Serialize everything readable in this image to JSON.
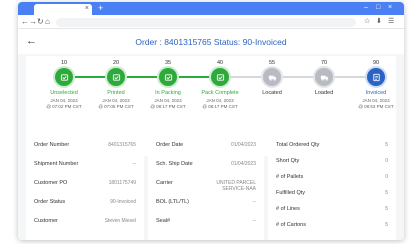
{
  "browser": {
    "new_tab": "+",
    "tab_close": "×",
    "nav_back": "←",
    "nav_forward": "→",
    "nav_reload": "↻",
    "nav_home": "⌂",
    "toolbar_icons": [
      "☆",
      "⬇",
      "☰"
    ],
    "window_controls": [
      "–",
      "□",
      "×"
    ]
  },
  "header": {
    "back": "←",
    "title": "Order : 8401315765  Status: 90-Invoiced"
  },
  "timeline": {
    "colors": {
      "green": "#2eaa3a",
      "grey": "#b8bcc2",
      "blue": "#2a63c4"
    },
    "steps": [
      {
        "number": "10",
        "label": "Unselected",
        "date1": "JAN 04, 2023",
        "date2": "@ 07:02 PM CST",
        "color": "green",
        "icon": "check-icon"
      },
      {
        "number": "20",
        "label": "Printed",
        "date1": "JAN 04, 2023",
        "date2": "@ 07:05 PM CST",
        "color": "green",
        "icon": "check-icon"
      },
      {
        "number": "35",
        "label": "In Packing",
        "date1": "JAN 04, 2023",
        "date2": "@ 08:17 PM CST",
        "color": "green",
        "icon": "check-icon"
      },
      {
        "number": "40",
        "label": "Pack Complete",
        "date1": "JAN 04, 2023",
        "date2": "@ 08:17 PM CST",
        "color": "green",
        "icon": "check-icon"
      },
      {
        "number": "55",
        "label": "Located",
        "date1": "",
        "date2": "",
        "color": "grey",
        "icon": "truck-icon"
      },
      {
        "number": "70",
        "label": "Loaded",
        "date1": "",
        "date2": "",
        "color": "grey",
        "icon": "truck-icon"
      },
      {
        "number": "90",
        "label": "Invoiced",
        "date1": "JAN 04, 2023",
        "date2": "@ 08:53 PM CST",
        "color": "blue",
        "icon": "invoice-icon"
      }
    ]
  },
  "details": {
    "left": [
      {
        "label": "Order Number",
        "value": "8401315765"
      },
      {
        "label": "Shipment Number",
        "value": "--"
      },
      {
        "label": "Customer PO",
        "value": "1801175749"
      },
      {
        "label": "Order Status",
        "value": "90-Invoiced"
      },
      {
        "label": "Customer",
        "value": "Steven Miesel"
      }
    ],
    "middle": [
      {
        "label": "Order Date",
        "value": "01/04/2023"
      },
      {
        "label": "Sch. Ship Date",
        "value": "01/04/2023"
      },
      {
        "label": "Carrier",
        "value": "UNITED PARCEL SERVICE-NAA"
      },
      {
        "label": "BOL (LTL/TL)",
        "value": "--"
      },
      {
        "label": "Seal#",
        "value": "--"
      }
    ],
    "right": [
      {
        "label": "Total Ordered Qty",
        "value": "5"
      },
      {
        "label": "Short Qty",
        "value": "0"
      },
      {
        "label": "# of Pallets",
        "value": "0"
      },
      {
        "label": "Fulfilled Qty",
        "value": "5"
      },
      {
        "label": "# of Lines",
        "value": "5"
      },
      {
        "label": "# of Cartons",
        "value": "5"
      }
    ]
  }
}
